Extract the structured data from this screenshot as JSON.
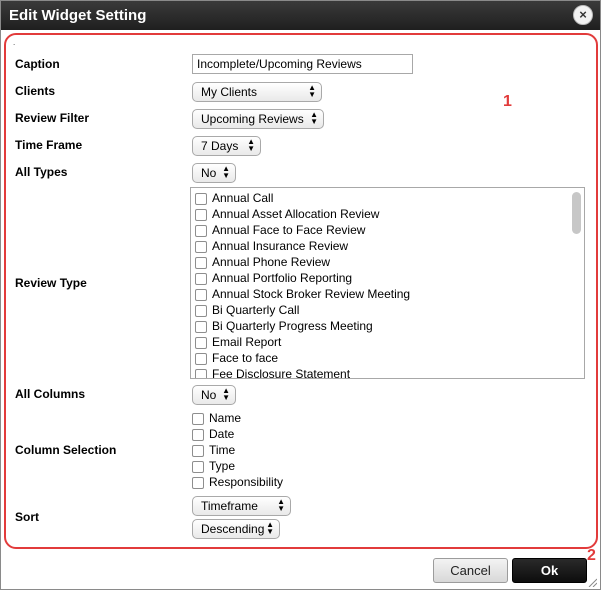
{
  "dialog": {
    "title": "Edit Widget Setting",
    "close_glyph": "×",
    "close_icon": "close-icon"
  },
  "annotations": {
    "marker1": "1",
    "marker2": "2",
    "color": "#e23b3b"
  },
  "form": {
    "dot": ".",
    "caption": {
      "label": "Caption",
      "value": "Incomplete/Upcoming Reviews"
    },
    "clients": {
      "label": "Clients",
      "value": "My Clients"
    },
    "review_filter": {
      "label": "Review Filter",
      "value": "Upcoming Reviews"
    },
    "time_frame": {
      "label": "Time Frame",
      "value": "7 Days"
    },
    "all_types": {
      "label": "All Types",
      "value": "No"
    },
    "review_type": {
      "label": "Review Type",
      "options": [
        "Annual Call",
        "Annual Asset Allocation Review",
        "Annual Face to Face Review",
        "Annual Insurance Review",
        "Annual Phone Review",
        "Annual Portfolio Reporting",
        "Annual Stock Broker Review Meeting",
        "Bi Quarterly Call",
        "Bi Quarterly Progress Meeting",
        "Email Report",
        "Face to face",
        "Fee Disclosure Statement"
      ]
    },
    "all_columns": {
      "label": "All Columns",
      "value": "No"
    },
    "column_selection": {
      "label": "Column Selection",
      "options": [
        "Name",
        "Date",
        "Time",
        "Type",
        "Responsibility"
      ]
    },
    "sort": {
      "label": "Sort",
      "field": "Timeframe",
      "direction": "Descending"
    }
  },
  "buttons": {
    "cancel": "Cancel",
    "ok": "Ok"
  },
  "colors": {
    "titlebar": "#262626",
    "ok_button": "#111111",
    "highlight": "#e23b3b"
  }
}
